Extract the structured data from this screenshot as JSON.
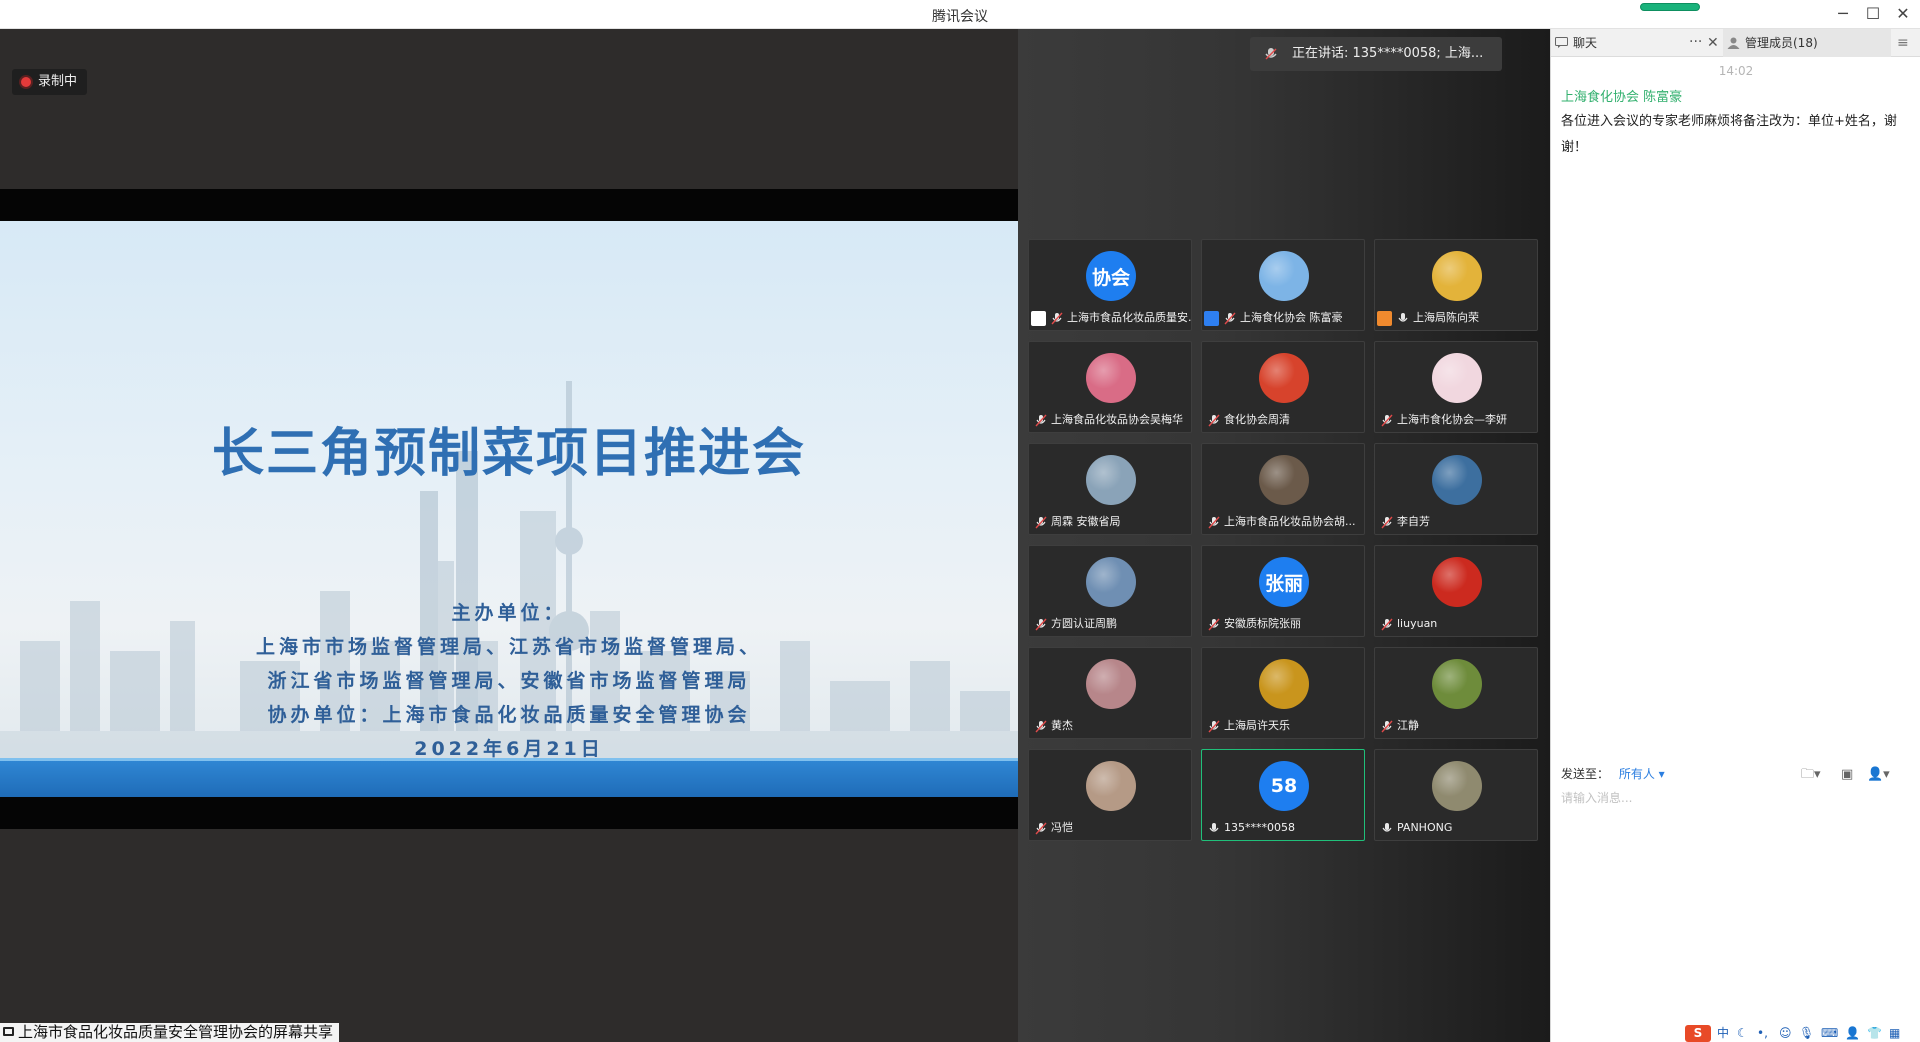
{
  "window": {
    "title": "腾讯会议",
    "controls": {
      "minimize": "─",
      "maximize": "☐",
      "close": "✕"
    }
  },
  "recording": {
    "label": "录制中"
  },
  "slide": {
    "title": "长三角预制菜项目推进会",
    "host_label": "主办单位：",
    "host_line1": "上海市市场监督管理局、江苏省市场监督管理局、",
    "host_line2": "浙江省市场监督管理局、安徽省市场监督管理局",
    "co_host": "协办单位：上海市食品化妆品质量安全管理协会",
    "date": "2022年6月21日"
  },
  "share_caption": "上海市食品化妆品质量安全管理协会的屏幕共享",
  "speaking": {
    "text": "正在讲话: 135****0058; 上海..."
  },
  "participants": [
    {
      "name": "上海市食品化妆品质量安...",
      "avatar_text": "协会",
      "avatar_color": "#1e7ef0",
      "tag": "screen-share-icon",
      "tag_color": "#ffffff",
      "mic": "muted"
    },
    {
      "name": "上海食化协会 陈富豪",
      "avatar_text": "",
      "avatar_color": "#7db4e6",
      "tag": "host-icon",
      "tag_color": "#2e7ff0",
      "mic": "muted"
    },
    {
      "name": "上海局陈向荣",
      "avatar_text": "",
      "avatar_color": "#e3b33a",
      "tag": "cohost-icon",
      "tag_color": "#f08a2e",
      "mic": "on"
    },
    {
      "name": "上海食品化妆品协会吴梅华",
      "avatar_text": "",
      "avatar_color": "#d96c86",
      "tag": "",
      "tag_color": "",
      "mic": "muted"
    },
    {
      "name": "食化协会周清",
      "avatar_text": "",
      "avatar_color": "#d7432c",
      "tag": "",
      "tag_color": "",
      "mic": "muted"
    },
    {
      "name": "上海市食化协会—李妍",
      "avatar_text": "",
      "avatar_color": "#f1d7df",
      "tag": "",
      "tag_color": "",
      "mic": "muted"
    },
    {
      "name": "周霖 安徽省局",
      "avatar_text": "",
      "avatar_color": "#8aa3b8",
      "tag": "",
      "tag_color": "",
      "mic": "muted"
    },
    {
      "name": "上海市食品化妆品协会胡...",
      "avatar_text": "",
      "avatar_color": "#6b5a4a",
      "tag": "",
      "tag_color": "",
      "mic": "muted"
    },
    {
      "name": "李自芳",
      "avatar_text": "",
      "avatar_color": "#3d6f9f",
      "tag": "",
      "tag_color": "",
      "mic": "muted"
    },
    {
      "name": "方圆认证周鹏",
      "avatar_text": "",
      "avatar_color": "#6f8fb3",
      "tag": "",
      "tag_color": "",
      "mic": "muted"
    },
    {
      "name": "安徽质标院张丽",
      "avatar_text": "张丽",
      "avatar_color": "#1e7ef0",
      "tag": "",
      "tag_color": "",
      "mic": "muted"
    },
    {
      "name": "liuyuan",
      "avatar_text": "",
      "avatar_color": "#cc2a1f",
      "tag": "",
      "tag_color": "",
      "mic": "muted"
    },
    {
      "name": "黄杰",
      "avatar_text": "",
      "avatar_color": "#b7868a",
      "tag": "",
      "tag_color": "",
      "mic": "muted"
    },
    {
      "name": "上海局许天乐",
      "avatar_text": "",
      "avatar_color": "#c9951d",
      "tag": "",
      "tag_color": "",
      "mic": "muted"
    },
    {
      "name": "江静",
      "avatar_text": "",
      "avatar_color": "#6e8c3b",
      "tag": "",
      "tag_color": "",
      "mic": "muted"
    },
    {
      "name": "冯恺",
      "avatar_text": "",
      "avatar_color": "#b59a86",
      "tag": "",
      "tag_color": "",
      "mic": "muted"
    },
    {
      "name": "135****0058",
      "avatar_text": "58",
      "avatar_color": "#1e7ef0",
      "tag": "",
      "tag_color": "",
      "mic": "on",
      "active": true
    },
    {
      "name": "PANHONG",
      "avatar_text": "",
      "avatar_color": "#8f8a6f",
      "tag": "",
      "tag_color": "",
      "mic": "on"
    }
  ],
  "chat": {
    "tab_chat": "聊天",
    "tab_more": "···",
    "tab_close": "✕",
    "tab_members": "管理成员(18)",
    "menu": "≡",
    "time": "14:02",
    "sender": "上海食化协会 陈富豪",
    "message": "各位进入会议的专家老师麻烦将备注改为：单位+姓名，谢谢！",
    "send_label": "发送至：",
    "send_target": "所有人",
    "input_placeholder": "请输入消息..."
  },
  "ime": {
    "logo": "S",
    "mode": "中"
  },
  "colors": {
    "accent": "#1e7ef0",
    "active_border": "#20c07a",
    "sender_green": "#32b06e",
    "slide_title": "#2f6fb3"
  }
}
